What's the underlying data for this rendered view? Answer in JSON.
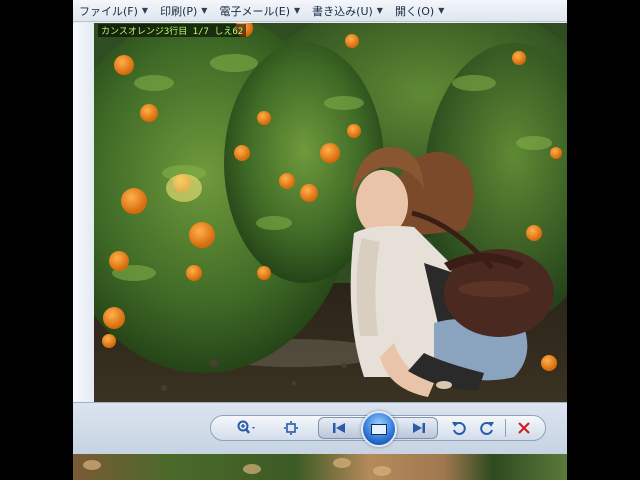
{
  "menubar": {
    "items": [
      {
        "label": "ファイル(F)"
      },
      {
        "label": "印刷(P)"
      },
      {
        "label": "電子メール(E)"
      },
      {
        "label": "書き込み(U)"
      },
      {
        "label": "開く(O)"
      }
    ]
  },
  "photo": {
    "caption": "カンスオレンジ3行目 1/7 しえ62"
  },
  "controls": {
    "zoom_icon": "zoom-icon",
    "fit_icon": "fit-window-icon",
    "previous_icon": "previous-icon",
    "slideshow_icon": "slideshow-icon",
    "next_icon": "next-icon",
    "rotate_ccw_icon": "rotate-counterclockwise-icon",
    "rotate_cw_icon": "rotate-clockwise-icon",
    "delete_icon": "delete-icon",
    "delete_color": "#cc2222",
    "accent_color": "#2a5aa8"
  }
}
